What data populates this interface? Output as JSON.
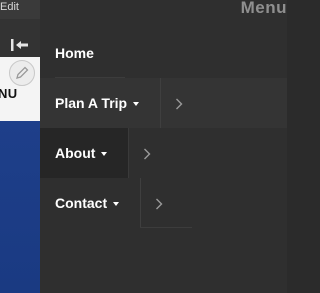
{
  "background_page": {
    "edit_label": "Edit",
    "menu_stub": "NU"
  },
  "panel": {
    "header": "Menu",
    "items": [
      {
        "label": "Home",
        "has_submenu": false
      },
      {
        "label": "Plan A Trip",
        "has_submenu": true
      },
      {
        "label": "About",
        "has_submenu": true
      },
      {
        "label": "Contact",
        "has_submenu": true
      }
    ]
  },
  "colors": {
    "panel_bg": "#2f2f2f",
    "text": "#ffffff",
    "header_text": "#8f8f8f",
    "page_blue": "#1e3f8a"
  },
  "icons": {
    "collapse": "collapse-left-icon",
    "edit": "pencil-icon",
    "submenu": "caret-down-icon",
    "expand": "chevron-right-icon"
  }
}
